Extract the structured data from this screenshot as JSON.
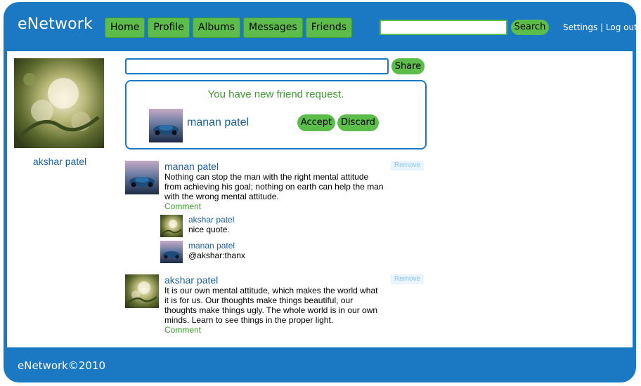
{
  "header": {
    "logo": "eNetwork",
    "nav": [
      "Home",
      "Profile",
      "Albums",
      "Messages",
      "Friends"
    ],
    "search_button": "Search",
    "settings_link": "Settings",
    "separator": "|",
    "logout_link": "Log out"
  },
  "sidebar": {
    "profile_name": "akshar patel"
  },
  "share": {
    "button": "Share"
  },
  "friend_request": {
    "title": "You have new friend request.",
    "name": "manan patel",
    "accept": "Accept",
    "discard": "Discard"
  },
  "posts": [
    {
      "author": "manan patel",
      "text": "Nothing can stop the man with the right mental attitude from achieving his goal; nothing on earth can help the man with the wrong mental attitude.",
      "comment_link": "Comment",
      "remove": "Remove",
      "comments": [
        {
          "author": "akshar patel",
          "text": "nice quote."
        },
        {
          "author": "manan patel",
          "text": "@akshar:thanx"
        }
      ]
    },
    {
      "author": "akshar patel",
      "text": "It is our own mental attitude, which makes the world what it is for us. Our thoughts make things beautiful, our thoughts make things ugly. The whole world is in our own minds. Learn to see things in the proper light.",
      "comment_link": "Comment",
      "remove": "Remove"
    }
  ],
  "footer": {
    "copyright": "eNetwork©2010"
  },
  "colors": {
    "brand_blue": "#1b78c2",
    "button_green": "#5cbd4a",
    "link_blue": "#1b5f9c",
    "accent_green": "#3f9a2f"
  }
}
